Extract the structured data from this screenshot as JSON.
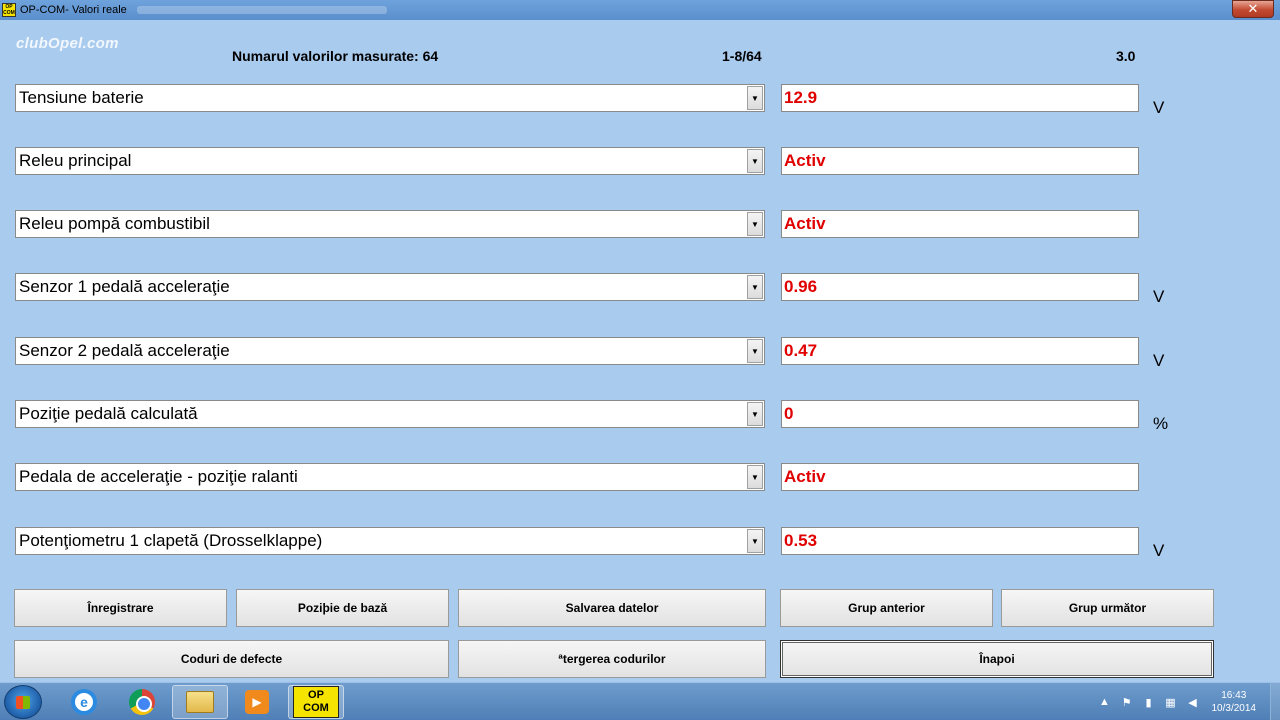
{
  "window": {
    "title": "OP-COM- Valori reale",
    "app_icon_text": "OP COM",
    "close": "✕"
  },
  "watermark": "clubOpel.com",
  "header": {
    "count_label": "Numarul valorilor masurate: 64",
    "page": "1-8/64",
    "version": "3.0"
  },
  "rows": [
    {
      "label": "Tensiune baterie",
      "value": "12.9",
      "unit": "V"
    },
    {
      "label": "Releu principal",
      "value": "Activ",
      "unit": ""
    },
    {
      "label": "Releu pompă combustibil",
      "value": "Activ",
      "unit": ""
    },
    {
      "label": "Senzor 1 pedală acceleraţie",
      "value": "0.96",
      "unit": "V"
    },
    {
      "label": "Senzor 2 pedală acceleraţie",
      "value": "0.47",
      "unit": "V"
    },
    {
      "label": "Poziţie pedală calculată",
      "value": "0",
      "unit": "%"
    },
    {
      "label": "Pedala de acceleraţie - poziţie ralanti",
      "value": "Activ",
      "unit": ""
    },
    {
      "label": "Potenţiometru 1 clapetă (Drosselklappe)",
      "value": "0.53",
      "unit": "V"
    }
  ],
  "buttons": {
    "record": "Înregistrare",
    "base_position": "Poziþie de bază",
    "save_data": "Salvarea datelor",
    "prev_group": "Grup anterior",
    "next_group": "Grup următor",
    "fault_codes": "Coduri de defecte",
    "clear_codes": "ªtergerea codurilor",
    "back": "Înapoi"
  },
  "taskbar": {
    "opcom_label": "OP COM",
    "time": "16:43",
    "date": "10/3/2014"
  },
  "colors": {
    "background": "#a9cbee",
    "value_text": "#e00000"
  }
}
